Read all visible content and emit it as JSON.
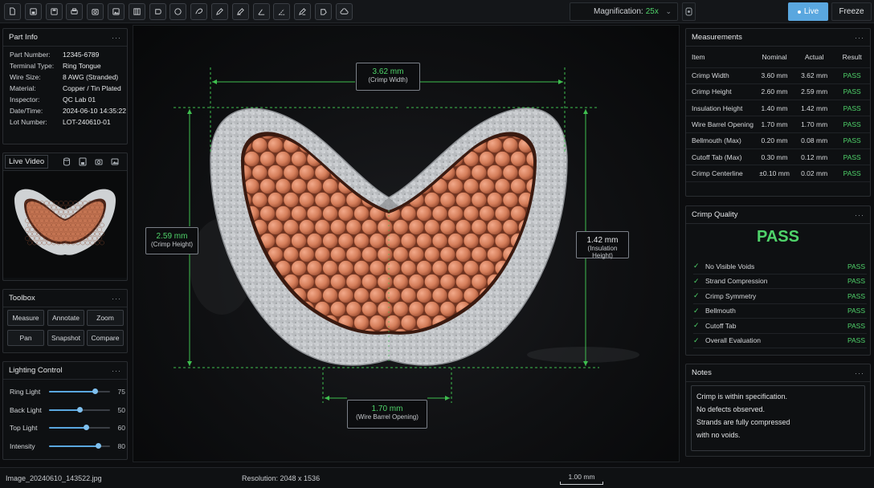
{
  "toolbar": {
    "tools": [
      "file-icon",
      "save-icon",
      "save-as-icon",
      "print-icon",
      "camera-icon",
      "image-icon",
      "grid-icon",
      "ellipse-icon",
      "circle-icon",
      "lasso-icon",
      "pencil-icon",
      "ruler-icon",
      "angle-icon",
      "measure-angle-icon",
      "annotate-icon",
      "polygon-icon",
      "cloud-icon"
    ],
    "magnification_label": "Magnification:",
    "magnification_value": "25x",
    "live_label": "Live",
    "freeze_label": "Freeze"
  },
  "part_info": {
    "title": "Part Info",
    "rows": [
      {
        "k": "Part Number:",
        "v": "12345-6789"
      },
      {
        "k": "Terminal Type:",
        "v": "Ring Tongue"
      },
      {
        "k": "Wire Size:",
        "v": "8 AWG (Stranded)"
      },
      {
        "k": "Material:",
        "v": "Copper / Tin Plated"
      },
      {
        "k": "Inspector:",
        "v": "QC Lab 01"
      },
      {
        "k": "Date/Time:",
        "v": "2024-06-10 14:35:22"
      },
      {
        "k": "Lot Number:",
        "v": "LOT-240610-01"
      }
    ]
  },
  "live_video": {
    "title": "Live Video"
  },
  "toolbox": {
    "title": "Toolbox",
    "buttons": [
      "Measure",
      "Annotate",
      "Zoom",
      "Pan",
      "Snapshot",
      "Compare"
    ]
  },
  "lighting": {
    "title": "Lighting Control",
    "rows": [
      {
        "label": "Ring Light",
        "value": 75
      },
      {
        "label": "Back Light",
        "value": 50
      },
      {
        "label": "Top Light",
        "value": 60
      },
      {
        "label": "Intensity",
        "value": 80
      }
    ]
  },
  "measurements": {
    "title": "Measurements",
    "headers": [
      "Item",
      "Nominal",
      "Actual",
      "Result"
    ],
    "rows": [
      {
        "item": "Crimp Width",
        "nominal": "3.60 mm",
        "actual": "3.62 mm",
        "result": "PASS"
      },
      {
        "item": "Crimp Height",
        "nominal": "2.60 mm",
        "actual": "2.59 mm",
        "result": "PASS"
      },
      {
        "item": "Insulation Height",
        "nominal": "1.40 mm",
        "actual": "1.42 mm",
        "result": "PASS"
      },
      {
        "item": "Wire Barrel Opening",
        "nominal": "1.70 mm",
        "actual": "1.70 mm",
        "result": "PASS"
      },
      {
        "item": "Bellmouth (Max)",
        "nominal": "0.20 mm",
        "actual": "0.08 mm",
        "result": "PASS"
      },
      {
        "item": "Cutoff Tab (Max)",
        "nominal": "0.30 mm",
        "actual": "0.12 mm",
        "result": "PASS"
      },
      {
        "item": "Crimp Centerline",
        "nominal": "±0.10 mm",
        "actual": "0.02 mm",
        "result": "PASS"
      }
    ]
  },
  "crimp_quality": {
    "title": "Crimp Quality",
    "overall": "PASS",
    "checks": [
      {
        "label": "No Visible Voids",
        "result": "PASS"
      },
      {
        "label": "Strand Compression",
        "result": "PASS"
      },
      {
        "label": "Crimp Symmetry",
        "result": "PASS"
      },
      {
        "label": "Bellmouth",
        "result": "PASS"
      },
      {
        "label": "Cutoff Tab",
        "result": "PASS"
      },
      {
        "label": "Overall Evaluation",
        "result": "PASS"
      }
    ]
  },
  "notes": {
    "title": "Notes",
    "lines": [
      "Crimp is within specification.",
      "No defects observed.",
      "Strands are fully compressed",
      "with no voids."
    ]
  },
  "callouts": {
    "width": {
      "value": "3.62 mm",
      "label": "(Crimp Width)"
    },
    "height": {
      "value": "2.59 mm",
      "label": "(Crimp Height)"
    },
    "insulation": {
      "value": "1.42 mm",
      "label": "(Insulation Height)"
    },
    "opening": {
      "value": "1.70 mm",
      "label": "(Wire Barrel Opening)"
    }
  },
  "status": {
    "filename": "Image_20240610_143522.jpg",
    "resolution": "Resolution: 2048 x 1536",
    "scale": "1.00 mm"
  },
  "colors": {
    "accent": "#5aa7df",
    "pass": "#4fd36a",
    "dim_line": "#3fbf4f"
  }
}
